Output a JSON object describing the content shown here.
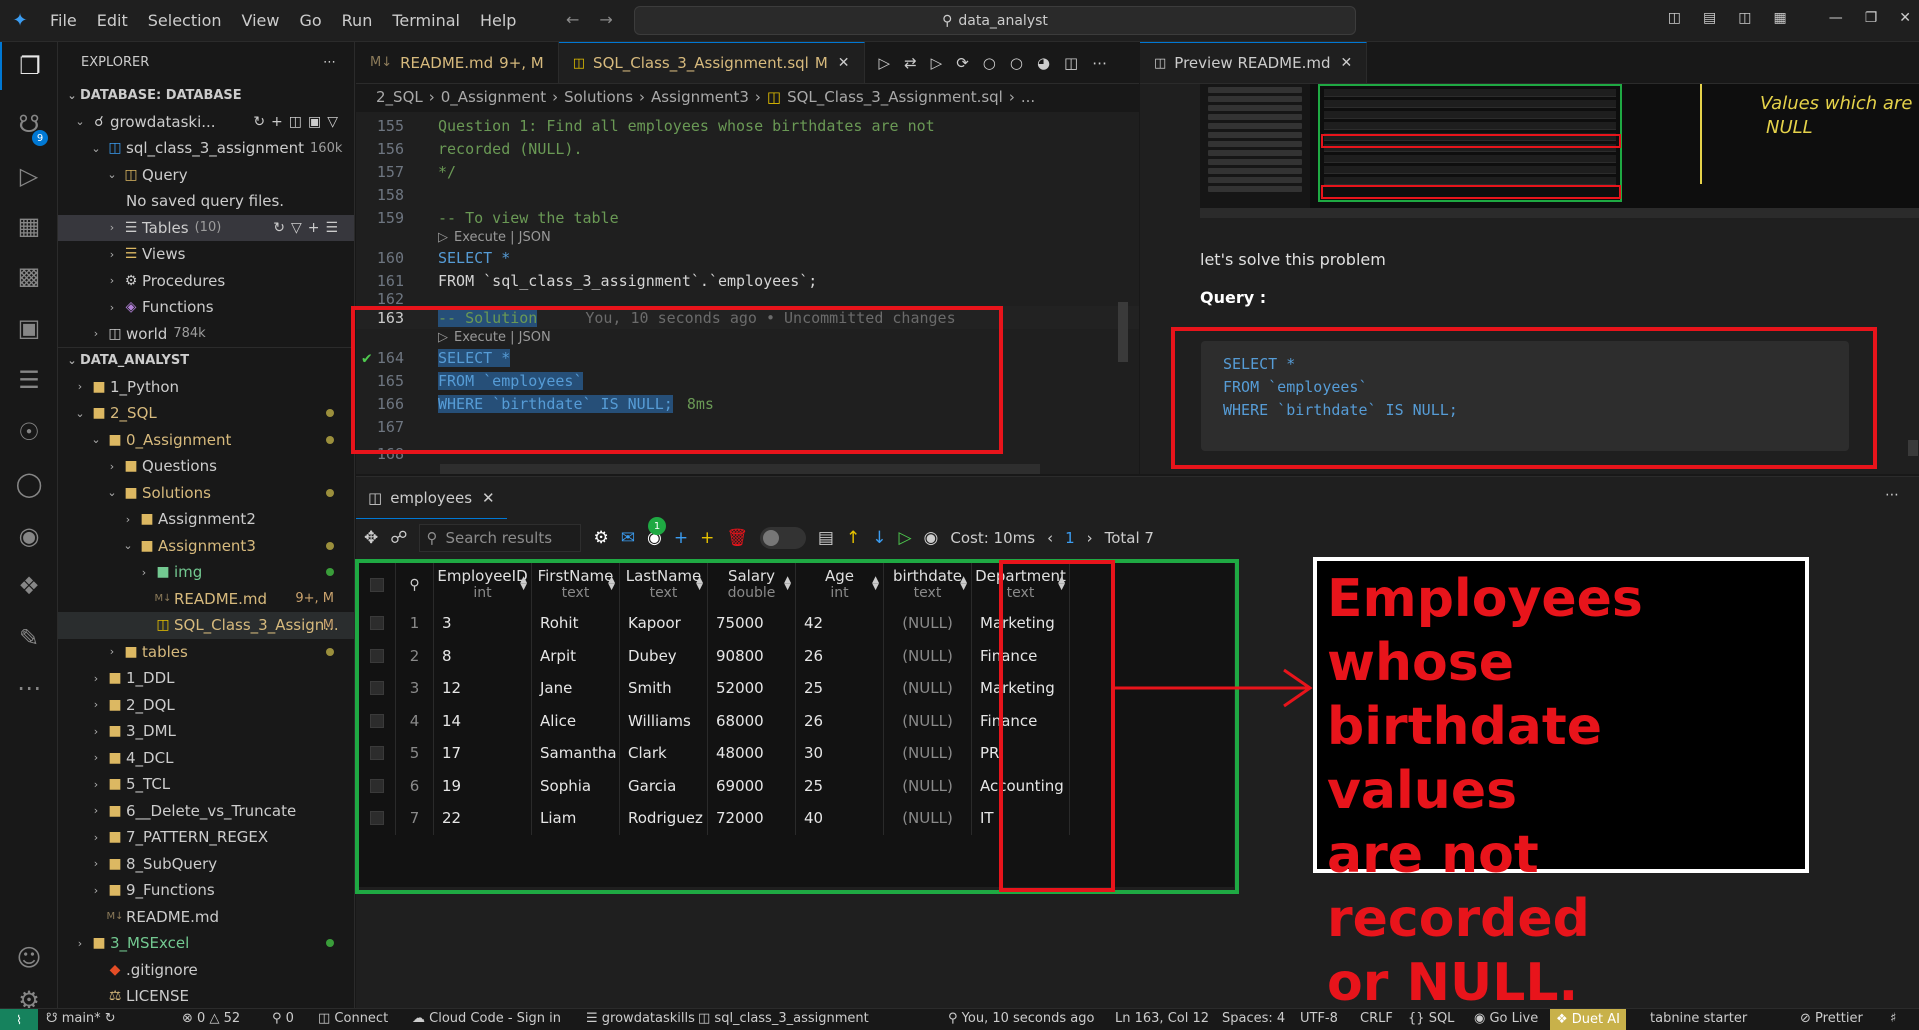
{
  "titlebar": {
    "menu": [
      "File",
      "Edit",
      "Selection",
      "View",
      "Go",
      "Run",
      "Terminal",
      "Help"
    ],
    "search": "data_analyst"
  },
  "activitybar": {
    "scm_badge": "9",
    "icons": [
      "explorer-icon",
      "source-control-icon",
      "run-debug-icon",
      "extensions-icon",
      "chart-icon",
      "remote-explorer-icon",
      "database-icon",
      "git-graph-icon",
      "search-history-icon",
      "github-icon",
      "duet-ai-icon",
      "notes-icon",
      "more-icon",
      "account-icon",
      "settings-icon"
    ]
  },
  "sidebar": {
    "title": "EXPLORER",
    "db_section": "DATABASE: DATABASE",
    "connection": "growdataski...",
    "database": "sql_class_3_assignment",
    "database_size": "160k",
    "query": "Query",
    "no_saved": "No saved query files.",
    "tables": "Tables",
    "tables_count": "(10)",
    "views": "Views",
    "procedures": "Procedures",
    "functions": "Functions",
    "world": "world",
    "world_size": "784k",
    "data_section": "DATA_ANALYST",
    "tree": [
      {
        "label": "1_Python"
      },
      {
        "label": "2_SQL"
      },
      {
        "label": "0_Assignment"
      },
      {
        "label": "Questions"
      },
      {
        "label": "Solutions"
      },
      {
        "label": "Assignment2"
      },
      {
        "label": "Assignment3"
      },
      {
        "label": "img"
      },
      {
        "label": "README.md",
        "status": "9+, M"
      },
      {
        "label": "SQL_Class_3_Assign...",
        "status": "M"
      },
      {
        "label": "tables"
      },
      {
        "label": "1_DDL"
      },
      {
        "label": "2_DQL"
      },
      {
        "label": "3_DML"
      },
      {
        "label": "4_DCL"
      },
      {
        "label": "5_TCL"
      },
      {
        "label": "6__Delete_vs_Truncate"
      },
      {
        "label": "7_PATTERN_REGEX"
      },
      {
        "label": "8_SubQuery"
      },
      {
        "label": "9_Functions"
      },
      {
        "label": "README.md"
      },
      {
        "label": "3_MSExcel"
      },
      {
        "label": ".gitignore"
      },
      {
        "label": "LICENSE"
      }
    ]
  },
  "editor": {
    "tabs": [
      {
        "label": "README.md",
        "status": "9+, M"
      },
      {
        "label": "SQL_Class_3_Assignment.sql",
        "status": "M"
      }
    ],
    "breadcrumb": [
      "2_SQL",
      "0_Assignment",
      "Solutions",
      "Assignment3",
      "SQL_Class_3_Assignment.sql",
      "..."
    ],
    "lens": "Execute | JSON",
    "lines": {
      "155": "Question 1: Find all employees whose birthdates are not",
      "156": "recorded (NULL).",
      "157": "*/",
      "158": "",
      "159": "-- To view the table",
      "160": "SELECT *",
      "161": "FROM `sql_class_3_assignment`.`employees`;",
      "162": "",
      "163": "-- Solution",
      "164": "SELECT *",
      "165": "FROM `employees`",
      "166": "WHERE `birthdate` IS NULL;",
      "167": "",
      "168": ""
    },
    "line_numbers": [
      "155",
      "156",
      "157",
      "158",
      "159",
      "160",
      "161",
      "162",
      "163",
      "164",
      "165",
      "166",
      "167",
      "168"
    ],
    "blame": "You, 10 seconds ago • Uncommitted changes",
    "timing": "8ms"
  },
  "preview": {
    "tab": "Preview README.md",
    "handwriting_line1": "Values which are",
    "handwriting_line2": "NULL",
    "text": "let's solve this problem",
    "query_label": "Query :",
    "code": [
      "SELECT *",
      "FROM `employees`",
      "WHERE `birthdate` IS NULL;"
    ]
  },
  "results": {
    "tab": "employees",
    "search_placeholder": "Search results",
    "mail_badge": "1",
    "cost": "Cost: 10ms",
    "page": "1",
    "total": "Total 7",
    "columns": [
      {
        "name": "EmployeeID",
        "type": "int"
      },
      {
        "name": "FirstName",
        "type": "text"
      },
      {
        "name": "LastName",
        "type": "text"
      },
      {
        "name": "Salary",
        "type": "double"
      },
      {
        "name": "Age",
        "type": "int"
      },
      {
        "name": "birthdate",
        "type": "text"
      },
      {
        "name": "Department",
        "type": "text"
      }
    ],
    "rows": [
      [
        "1",
        "3",
        "Rohit",
        "Kapoor",
        "75000",
        "42",
        "(NULL)",
        "Marketing"
      ],
      [
        "2",
        "8",
        "Arpit",
        "Dubey",
        "90800",
        "26",
        "(NULL)",
        "Finance"
      ],
      [
        "3",
        "12",
        "Jane",
        "Smith",
        "52000",
        "25",
        "(NULL)",
        "Marketing"
      ],
      [
        "4",
        "14",
        "Alice",
        "Williams",
        "68000",
        "26",
        "(NULL)",
        "Finance"
      ],
      [
        "5",
        "17",
        "Samantha",
        "Clark",
        "48000",
        "30",
        "(NULL)",
        "PR"
      ],
      [
        "6",
        "19",
        "Sophia",
        "Garcia",
        "69000",
        "25",
        "(NULL)",
        "Accounting"
      ],
      [
        "7",
        "22",
        "Liam",
        "Rodriguez",
        "72000",
        "40",
        "(NULL)",
        "IT"
      ]
    ],
    "annotation": [
      "Employees whose",
      "birthdate values",
      "are not recorded",
      "or NULL."
    ]
  },
  "statusbar": {
    "branch": "main*",
    "problems": "0",
    "warnings": "52",
    "ports": "0",
    "connect": "Connect",
    "cloud": "Cloud Code - Sign in",
    "conn_name": "growdataskills",
    "db_name": "sql_class_3_assignment",
    "blame": "You, 10 seconds ago",
    "position": "Ln 163, Col 12",
    "spaces": "Spaces: 4",
    "encoding": "UTF-8",
    "eol": "CRLF",
    "lang": "SQL",
    "golive": "Go Live",
    "duet": "Duet AI",
    "tabnine": "tabnine starter",
    "prettier": "Prettier"
  },
  "colors": {
    "accent": "#0078d4",
    "highlight_red": "#e8141b",
    "highlight_green": "#1fa943",
    "keyword": "#569cd6",
    "string": "#ce9178",
    "comment": "#6a9955"
  }
}
